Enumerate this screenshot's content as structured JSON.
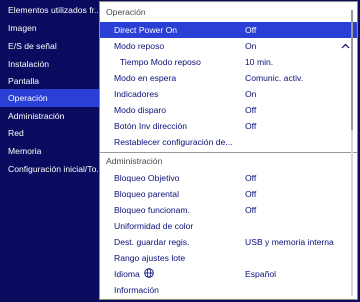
{
  "sidebar": {
    "items": [
      {
        "label": "Elementos utilizados fr..."
      },
      {
        "label": "Imagen"
      },
      {
        "label": "E/S de señal"
      },
      {
        "label": "Instalación"
      },
      {
        "label": "Pantalla"
      },
      {
        "label": "Operación"
      },
      {
        "label": "Administración"
      },
      {
        "label": "Red"
      },
      {
        "label": "Memoria"
      },
      {
        "label": "Configuración inicial/To..."
      }
    ],
    "active_index": 5
  },
  "panel": {
    "section1_title": "Operación",
    "section1_rows": [
      {
        "label": "Direct Power On",
        "value": "Off"
      },
      {
        "label": "Modo reposo",
        "value": "On"
      },
      {
        "label": "Tiempo Modo reposo",
        "value": "10 min."
      },
      {
        "label": "Modo en espera",
        "value": "Comunic. activ."
      },
      {
        "label": "Indicadores",
        "value": "On"
      },
      {
        "label": "Modo disparo",
        "value": "Off"
      },
      {
        "label": "Botón Inv dirección",
        "value": "Off"
      },
      {
        "label": "Restablecer configuración de...",
        "value": ""
      }
    ],
    "section2_title": "Administración",
    "section2_rows": [
      {
        "label": "Bloqueo Objetivo",
        "value": "Off"
      },
      {
        "label": "Bloqueo parental",
        "value": "Off"
      },
      {
        "label": "Bloqueo funcionam.",
        "value": "Off"
      },
      {
        "label": "Uniformidad de color",
        "value": ""
      },
      {
        "label": "Dest. guardar regis.",
        "value": "USB y memoria interna"
      },
      {
        "label": "Rango ajustes lote",
        "value": ""
      },
      {
        "label": "Idioma",
        "value": "Español"
      },
      {
        "label": "Información",
        "value": ""
      }
    ]
  },
  "colors": {
    "background": "#0a0b5e",
    "highlight": "#2a3fd6",
    "text_dark": "#0b0f7a"
  },
  "icons": {
    "expand": "chevron-up-icon",
    "language": "globe-icon"
  }
}
